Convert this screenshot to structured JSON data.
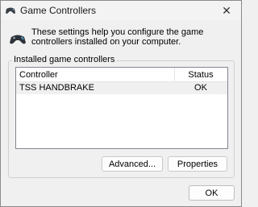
{
  "window": {
    "title": "Game Controllers",
    "close_symbol": "✕"
  },
  "intro": {
    "text": "These settings help you configure the game controllers installed on your computer."
  },
  "group": {
    "label": "Installed game controllers"
  },
  "table": {
    "columns": [
      "Controller",
      "Status"
    ],
    "rows": [
      {
        "controller": "TSS HANDBRAKE",
        "status": "OK"
      }
    ]
  },
  "buttons": {
    "advanced": "Advanced...",
    "properties": "Properties",
    "ok": "OK"
  },
  "icons": {
    "title": "gamepad-icon",
    "intro": "gamepad-icon",
    "close": "close-icon"
  }
}
